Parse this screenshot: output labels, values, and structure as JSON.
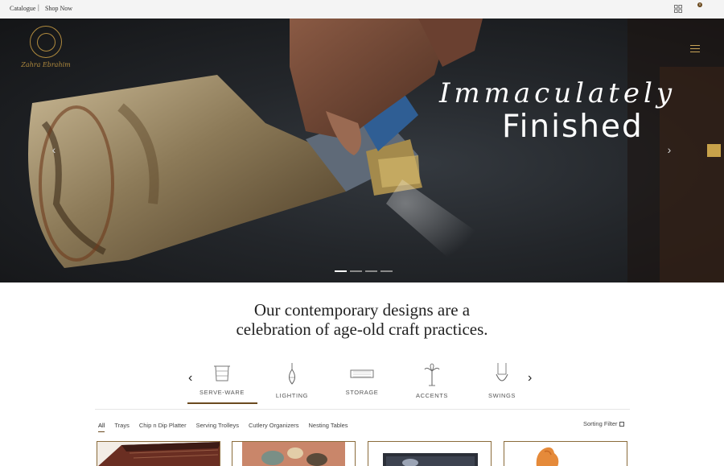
{
  "topbar": {
    "catalogue": "Catalogue",
    "separator": "|",
    "shop_now": "Shop Now",
    "cart_count": "0"
  },
  "hero": {
    "logo_text": "Zahra Ebrahim",
    "script_text": "Immaculately",
    "main_text": "Finished",
    "prev_glyph": "‹",
    "next_glyph": "›",
    "slide_count": 4,
    "active_slide": 1
  },
  "tagline": {
    "line1": "Our contemporary designs are a",
    "line2": "celebration of age-old craft practices."
  },
  "categories": {
    "prev_glyph": "‹",
    "next_glyph": "›",
    "items": [
      {
        "label": "SERVE-WARE",
        "icon": "serveware-icon"
      },
      {
        "label": "LIGHTING",
        "icon": "lighting-icon"
      },
      {
        "label": "STORAGE",
        "icon": "storage-icon"
      },
      {
        "label": "ACCENTS",
        "icon": "accents-icon"
      },
      {
        "label": "SWINGS",
        "icon": "swing-icon"
      }
    ],
    "active": "SERVE-WARE"
  },
  "filters": {
    "items": [
      "All",
      "Trays",
      "Chip n Dip Platter",
      "Serving Trolleys",
      "Cutlery Organizers",
      "Nesting Tables"
    ],
    "active": "All",
    "sorting_label": "Sorting Filter"
  },
  "colors": {
    "accent_brown": "#6b4a1f",
    "gold": "#c8a24a"
  }
}
